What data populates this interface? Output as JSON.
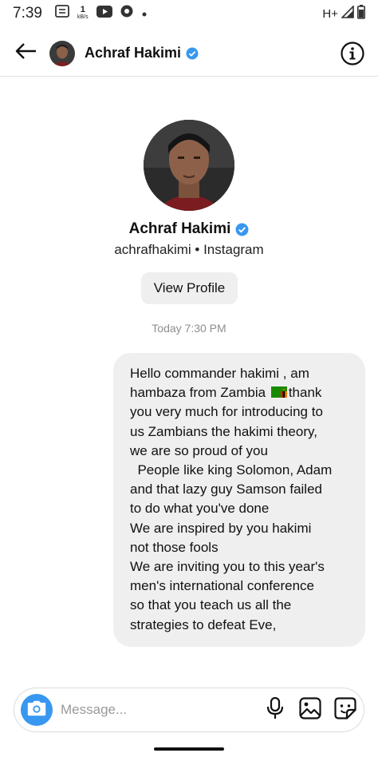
{
  "status_bar": {
    "time": "7:39",
    "speed_value": "1",
    "speed_unit": "kB/s",
    "network": "H+",
    "icons": [
      "notification-icon",
      "youtube-icon",
      "app-icon",
      "dot-icon",
      "signal-icon",
      "battery-icon"
    ]
  },
  "header": {
    "back_icon": "arrow-left-icon",
    "name": "Achraf Hakimi",
    "verified_icon": "verified-badge-icon",
    "info_icon": "info-icon"
  },
  "profile": {
    "name": "Achraf Hakimi",
    "handle_line": "achrafhakimi • Instagram",
    "view_profile_label": "View Profile"
  },
  "timestamp": "Today 7:30 PM",
  "message": {
    "lines": [
      "Hello commander hakimi , am",
      "hambaza from Zambia",
      "thank",
      "you very much for introducing to",
      "us Zambians the hakimi theory,",
      "we are so proud of you",
      "  People like king Solomon, Adam",
      "and that lazy guy Samson failed",
      "to do what you've done",
      "We are inspired by you hakimi",
      "not those fools",
      "We are inviting you to this year's",
      "men's international conference",
      "so that you teach us all the",
      "strategies to defeat Eve,"
    ],
    "emoji_icon": "zambia-flag-icon"
  },
  "composer": {
    "placeholder": "Message...",
    "icons": [
      "camera-icon",
      "microphone-icon",
      "gallery-icon",
      "sticker-icon"
    ]
  },
  "colors": {
    "accent": "#3897f0",
    "verified": "#3897f0",
    "bubble": "#efefef",
    "muted_text": "#8e8e8e"
  }
}
